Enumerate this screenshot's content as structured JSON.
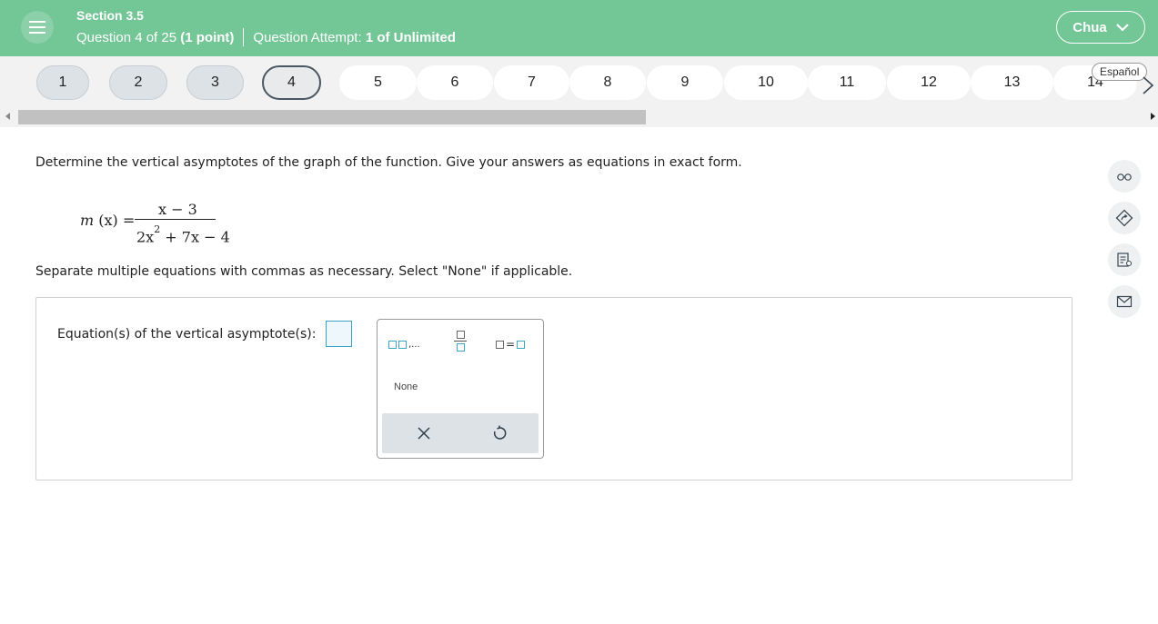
{
  "header": {
    "section": "Section 3.5",
    "question_prefix": "Question 4 of 25",
    "question_points": "(1 point)",
    "attempt_label": "Question Attempt:",
    "attempt_value": "1 of Unlimited",
    "user_name": "Chua",
    "bg_color": "#73c696"
  },
  "nav": {
    "questions": [
      "1",
      "2",
      "3",
      "4",
      "5",
      "6",
      "7",
      "8",
      "9",
      "10",
      "11",
      "12",
      "13",
      "14"
    ],
    "answered": [
      1,
      2,
      3
    ],
    "current": 4,
    "language_button": "Español"
  },
  "question": {
    "prompt": "Determine the vertical asymptotes of the graph of the function. Give your answers as equations in exact form.",
    "formula": {
      "lhs_func": "m",
      "lhs_var": "(x) =",
      "numerator": "x − 3",
      "denominator_a": "2x",
      "denominator_exp": "2",
      "denominator_b": " + 7x − 4"
    },
    "instructions": "Separate multiple equations with commas as necessary. Select \"None\" if applicable."
  },
  "answer": {
    "label": "Equation(s) of the vertical asymptote(s):",
    "value": ""
  },
  "palette": {
    "list_suffix": ",...",
    "equals": "=",
    "none_label": "None"
  },
  "tools": [
    "glasses-icon",
    "hint-icon",
    "notes-icon",
    "mail-icon"
  ]
}
